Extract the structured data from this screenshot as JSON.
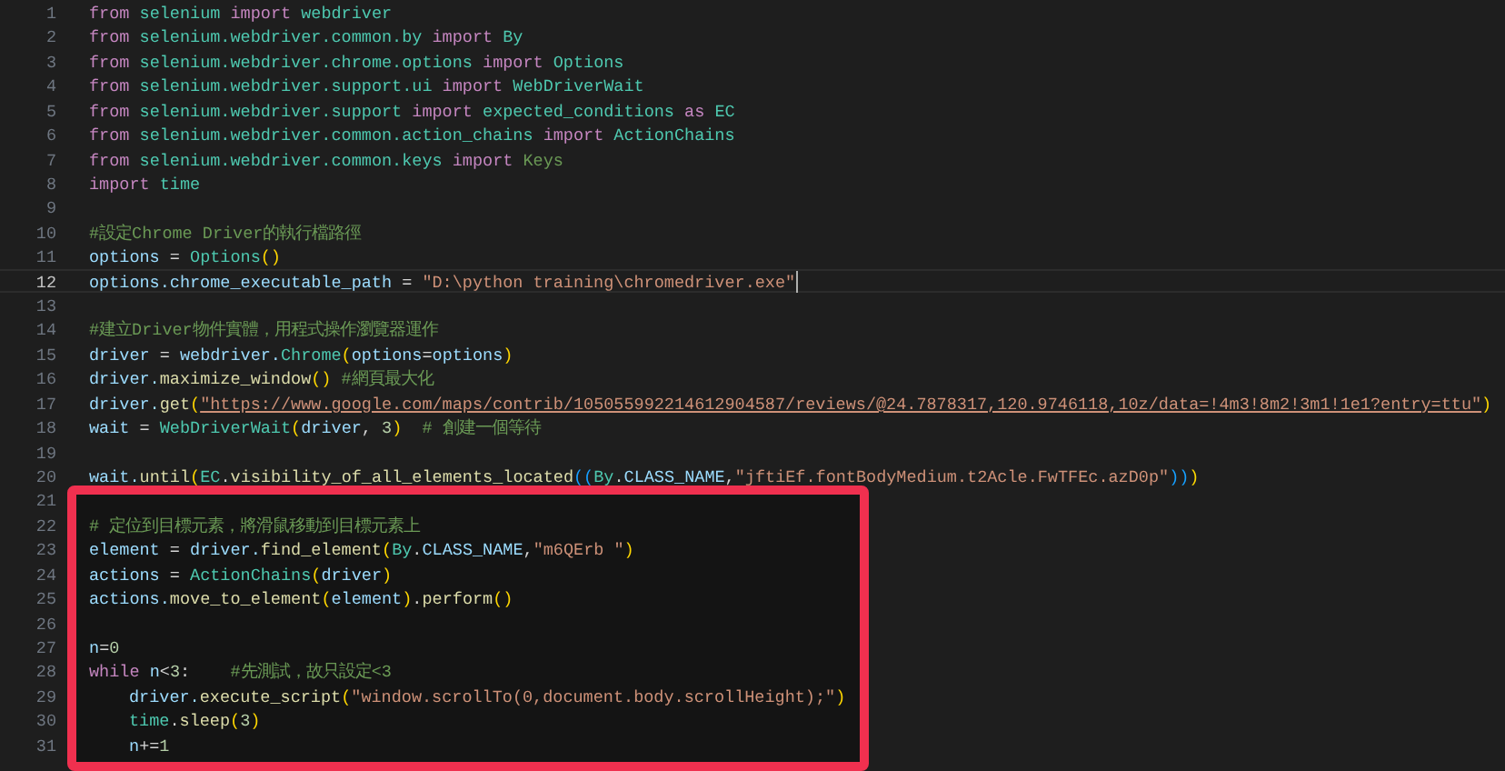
{
  "editor": {
    "blocks": [
      {
        "highlighted": false,
        "lines": [
          {
            "number": "1",
            "current": false,
            "tokens": [
              {
                "kind": "kw",
                "text": "from"
              },
              {
                "kind": "mod",
                "text": " selenium "
              },
              {
                "kind": "kw",
                "text": "import"
              },
              {
                "kind": "mod",
                "text": " webdriver"
              }
            ]
          },
          {
            "number": "2",
            "current": false,
            "tokens": [
              {
                "kind": "kw",
                "text": "from"
              },
              {
                "kind": "mod",
                "text": " selenium.webdriver.common.by "
              },
              {
                "kind": "kw",
                "text": "import"
              },
              {
                "kind": "mod",
                "text": " By"
              }
            ]
          },
          {
            "number": "3",
            "current": false,
            "tokens": [
              {
                "kind": "kw",
                "text": "from"
              },
              {
                "kind": "mod",
                "text": " selenium.webdriver.chrome.options "
              },
              {
                "kind": "kw",
                "text": "import"
              },
              {
                "kind": "mod",
                "text": " Options"
              }
            ]
          },
          {
            "number": "4",
            "current": false,
            "tokens": [
              {
                "kind": "kw",
                "text": "from"
              },
              {
                "kind": "mod",
                "text": " selenium.webdriver.support.ui "
              },
              {
                "kind": "kw",
                "text": "import"
              },
              {
                "kind": "mod",
                "text": " WebDriverWait"
              }
            ]
          },
          {
            "number": "5",
            "current": false,
            "tokens": [
              {
                "kind": "kw",
                "text": "from"
              },
              {
                "kind": "mod",
                "text": " selenium.webdriver.support "
              },
              {
                "kind": "kw",
                "text": "import"
              },
              {
                "kind": "mod",
                "text": " expected_conditions "
              },
              {
                "kind": "kw",
                "text": "as"
              },
              {
                "kind": "mod",
                "text": " EC"
              }
            ]
          },
          {
            "number": "6",
            "current": false,
            "tokens": [
              {
                "kind": "kw",
                "text": "from"
              },
              {
                "kind": "mod",
                "text": " selenium.webdriver.common.action_chains "
              },
              {
                "kind": "kw",
                "text": "import"
              },
              {
                "kind": "mod",
                "text": " ActionChains"
              }
            ]
          },
          {
            "number": "7",
            "current": false,
            "tokens": [
              {
                "kind": "kw",
                "text": "from"
              },
              {
                "kind": "mod",
                "text": " selenium.webdriver.common.keys "
              },
              {
                "kind": "kw",
                "text": "import"
              },
              {
                "kind": "cmt",
                "text": " Keys"
              }
            ]
          },
          {
            "number": "8",
            "current": false,
            "tokens": [
              {
                "kind": "kw",
                "text": "import"
              },
              {
                "kind": "mod",
                "text": " time"
              }
            ]
          },
          {
            "number": "9",
            "current": false
          },
          {
            "number": "10",
            "current": false,
            "tokens": [
              {
                "kind": "cmt",
                "text": "#設定Chrome Driver的執行檔路徑"
              }
            ]
          },
          {
            "number": "11",
            "current": false,
            "tokens": [
              {
                "kind": "var",
                "text": "options"
              },
              {
                "kind": "plain",
                "text": " = "
              },
              {
                "kind": "cls",
                "text": "Options"
              },
              {
                "kind": "paren",
                "text": "()"
              }
            ]
          },
          {
            "number": "12",
            "current": true,
            "tokens": [
              {
                "kind": "var",
                "text": "options.chrome_executable_path"
              },
              {
                "kind": "plain",
                "text": " = "
              },
              {
                "kind": "str",
                "text": "\"D:\\python training\\chromedriver.exe\""
              }
            ]
          },
          {
            "number": "13",
            "current": false
          },
          {
            "number": "14",
            "current": false,
            "tokens": [
              {
                "kind": "cmt",
                "text": "#建立Driver物件實體，用程式操作瀏覽器運作"
              }
            ]
          },
          {
            "number": "15",
            "current": false,
            "tokens": [
              {
                "kind": "var",
                "text": "driver"
              },
              {
                "kind": "plain",
                "text": " = "
              },
              {
                "kind": "var",
                "text": "webdriver."
              },
              {
                "kind": "cls",
                "text": "Chrome"
              },
              {
                "kind": "paren",
                "text": "("
              },
              {
                "kind": "var",
                "text": "options"
              },
              {
                "kind": "plain",
                "text": "="
              },
              {
                "kind": "var",
                "text": "options"
              },
              {
                "kind": "paren",
                "text": ")"
              }
            ]
          },
          {
            "number": "16",
            "current": false,
            "tokens": [
              {
                "kind": "var",
                "text": "driver."
              },
              {
                "kind": "fn",
                "text": "maximize_window"
              },
              {
                "kind": "paren",
                "text": "()"
              },
              {
                "kind": "cmt",
                "text": " #網頁最大化"
              }
            ]
          },
          {
            "number": "17",
            "current": false,
            "tokens": [
              {
                "kind": "var",
                "text": "driver."
              },
              {
                "kind": "fn",
                "text": "get"
              },
              {
                "kind": "paren",
                "text": "("
              },
              {
                "kind": "link",
                "text": "\"https://www.google.com/maps/contrib/105055992214612904587/reviews/@24.7878317,120.9746118,10z/data=!4m3!8m2!3m1!1e1?entry=ttu\""
              },
              {
                "kind": "paren",
                "text": ")"
              }
            ]
          },
          {
            "number": "18",
            "current": false,
            "tokens": [
              {
                "kind": "var",
                "text": "wait"
              },
              {
                "kind": "plain",
                "text": " = "
              },
              {
                "kind": "cls",
                "text": "WebDriverWait"
              },
              {
                "kind": "paren",
                "text": "("
              },
              {
                "kind": "var",
                "text": "driver"
              },
              {
                "kind": "plain",
                "text": ", "
              },
              {
                "kind": "num",
                "text": "3"
              },
              {
                "kind": "paren",
                "text": ")"
              },
              {
                "kind": "cmt",
                "text": "  # 創建一個等待"
              }
            ]
          },
          {
            "number": "19",
            "current": false
          },
          {
            "number": "20",
            "current": false,
            "tokens": [
              {
                "kind": "var",
                "text": "wait."
              },
              {
                "kind": "fn",
                "text": "until"
              },
              {
                "kind": "paren",
                "text": "("
              },
              {
                "kind": "cls",
                "text": "EC"
              },
              {
                "kind": "plain",
                "text": "."
              },
              {
                "kind": "fn",
                "text": "visibility_of_all_elements_located"
              },
              {
                "kind": "paren2",
                "text": "(("
              },
              {
                "kind": "cls",
                "text": "By"
              },
              {
                "kind": "plain",
                "text": "."
              },
              {
                "kind": "var",
                "text": "CLASS_NAME"
              },
              {
                "kind": "plain",
                "text": ","
              },
              {
                "kind": "str",
                "text": "\"jftiEf.fontBodyMedium.t2Acle.FwTFEc.azD0p\""
              },
              {
                "kind": "paren2",
                "text": "))"
              },
              {
                "kind": "paren",
                "text": ")"
              }
            ]
          }
        ]
      },
      {
        "highlighted": true,
        "lines": [
          {
            "number": "21",
            "current": false
          },
          {
            "number": "22",
            "current": false,
            "tokens": [
              {
                "kind": "cmt",
                "text": "# 定位到目標元素，將滑鼠移動到目標元素上"
              }
            ]
          },
          {
            "number": "23",
            "current": false,
            "tokens": [
              {
                "kind": "var",
                "text": "element"
              },
              {
                "kind": "plain",
                "text": " = "
              },
              {
                "kind": "var",
                "text": "driver."
              },
              {
                "kind": "fn",
                "text": "find_element"
              },
              {
                "kind": "paren",
                "text": "("
              },
              {
                "kind": "cls",
                "text": "By"
              },
              {
                "kind": "plain",
                "text": "."
              },
              {
                "kind": "var",
                "text": "CLASS_NAME"
              },
              {
                "kind": "plain",
                "text": ","
              },
              {
                "kind": "str",
                "text": "\"m6QErb \""
              },
              {
                "kind": "paren",
                "text": ")"
              }
            ]
          },
          {
            "number": "24",
            "current": false,
            "tokens": [
              {
                "kind": "var",
                "text": "actions"
              },
              {
                "kind": "plain",
                "text": " = "
              },
              {
                "kind": "cls",
                "text": "ActionChains"
              },
              {
                "kind": "paren",
                "text": "("
              },
              {
                "kind": "var",
                "text": "driver"
              },
              {
                "kind": "paren",
                "text": ")"
              }
            ]
          },
          {
            "number": "25",
            "current": false,
            "tokens": [
              {
                "kind": "var",
                "text": "actions."
              },
              {
                "kind": "fn",
                "text": "move_to_element"
              },
              {
                "kind": "paren",
                "text": "("
              },
              {
                "kind": "var",
                "text": "element"
              },
              {
                "kind": "paren",
                "text": ")"
              },
              {
                "kind": "plain",
                "text": "."
              },
              {
                "kind": "fn",
                "text": "perform"
              },
              {
                "kind": "paren",
                "text": "()"
              }
            ]
          },
          {
            "number": "26",
            "current": false
          },
          {
            "number": "27",
            "current": false,
            "tokens": [
              {
                "kind": "var",
                "text": "n"
              },
              {
                "kind": "plain",
                "text": "="
              },
              {
                "kind": "num",
                "text": "0"
              }
            ]
          },
          {
            "number": "28",
            "current": false,
            "tokens": [
              {
                "kind": "kw",
                "text": "while "
              },
              {
                "kind": "var",
                "text": "n"
              },
              {
                "kind": "plain",
                "text": "<"
              },
              {
                "kind": "num",
                "text": "3"
              },
              {
                "kind": "plain",
                "text": ":    "
              },
              {
                "kind": "cmt",
                "text": "#先測試，故只設定<3"
              }
            ],
            "children": [
              {
                "number": "29",
                "current": false,
                "tokens": [
                  {
                    "kind": "var",
                    "text": "driver."
                  },
                  {
                    "kind": "fn",
                    "text": "execute_script"
                  },
                  {
                    "kind": "paren",
                    "text": "("
                  },
                  {
                    "kind": "str",
                    "text": "\"window.scrollTo(0,document.body.scrollHeight);\""
                  },
                  {
                    "kind": "paren",
                    "text": ")"
                  }
                ]
              },
              {
                "number": "30",
                "current": false,
                "tokens": [
                  {
                    "kind": "cls",
                    "text": "time"
                  },
                  {
                    "kind": "plain",
                    "text": "."
                  },
                  {
                    "kind": "fn",
                    "text": "sleep"
                  },
                  {
                    "kind": "paren",
                    "text": "("
                  },
                  {
                    "kind": "num",
                    "text": "3"
                  },
                  {
                    "kind": "paren",
                    "text": ")"
                  }
                ]
              },
              {
                "number": "31",
                "current": false,
                "tokens": [
                  {
                    "kind": "var",
                    "text": "n"
                  },
                  {
                    "kind": "plain",
                    "text": "+="
                  },
                  {
                    "kind": "num",
                    "text": "1"
                  }
                ]
              }
            ]
          }
        ]
      }
    ]
  }
}
